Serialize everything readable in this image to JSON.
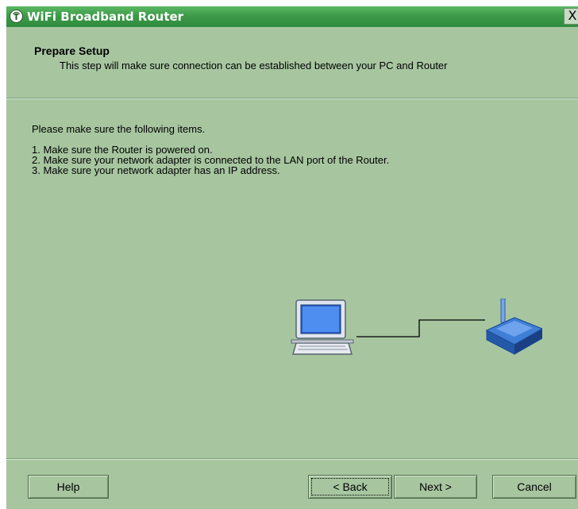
{
  "window": {
    "title": "WiFi Broadband Router",
    "close_label": "X"
  },
  "header": {
    "title": "Prepare Setup",
    "subtitle": "This step will make sure connection can be established between your PC and Router"
  },
  "content": {
    "intro": "Please make sure the following items.",
    "steps": [
      "1. Make sure the Router is powered on.",
      "2. Make sure your network adapter is connected to the LAN port of the Router.",
      "3. Make sure your network adapter has an IP address."
    ]
  },
  "buttons": {
    "help": "Help",
    "back": "< Back",
    "next": "Next >",
    "cancel": "Cancel"
  },
  "icons": {
    "app": "router-antenna-icon",
    "computer": "computer-icon",
    "router": "router-icon"
  },
  "colors": {
    "dialog_bg": "#a7c6a0",
    "titlebar": "#3e9a4a"
  }
}
